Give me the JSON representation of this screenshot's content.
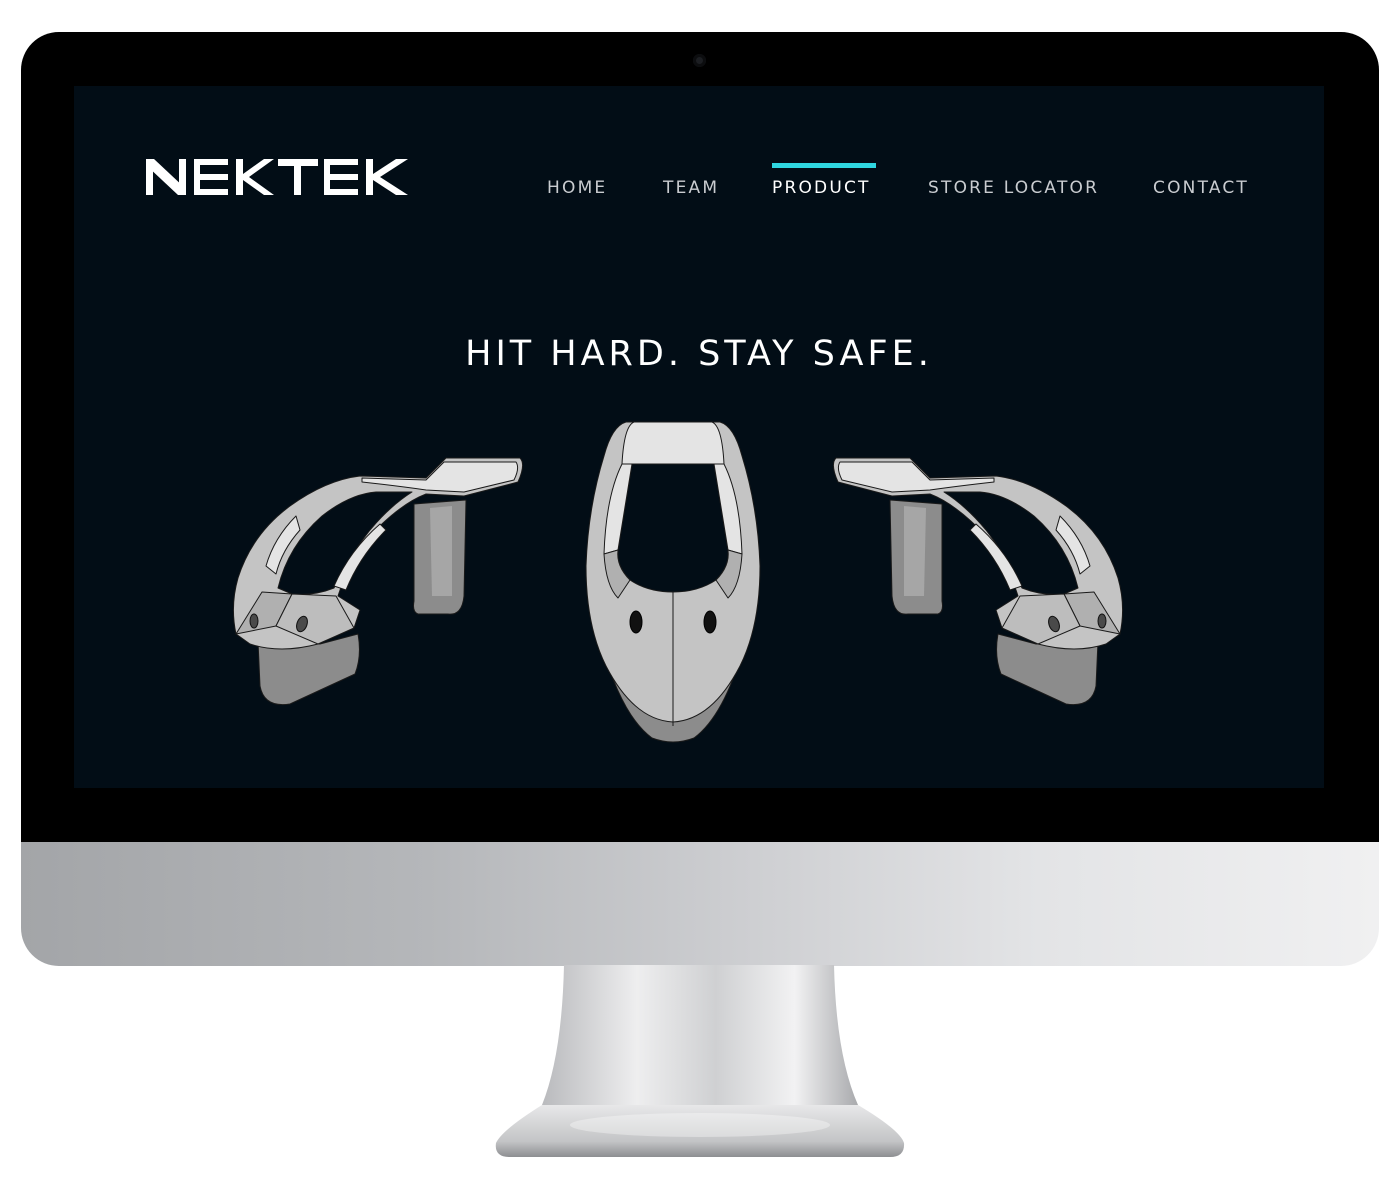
{
  "brand": {
    "logo_text": "NEKTEK"
  },
  "nav": {
    "items": [
      {
        "label": "HOME"
      },
      {
        "label": "TEAM"
      },
      {
        "label": "PRODUCT",
        "active": true
      },
      {
        "label": "STORE LOCATOR"
      },
      {
        "label": "CONTACT"
      }
    ]
  },
  "hero": {
    "headline": "HIT HARD. STAY SAFE."
  },
  "colors": {
    "screen_bg": "#020d16",
    "accent": "#2fd6e0",
    "product_light": "#c4c4c4",
    "product_dark": "#8a8a8a",
    "product_white": "#e6e6e6"
  },
  "icons": {
    "camera": "webcam-icon",
    "products": [
      "neck-brace-left-view",
      "neck-brace-front-view",
      "neck-brace-right-view"
    ]
  }
}
